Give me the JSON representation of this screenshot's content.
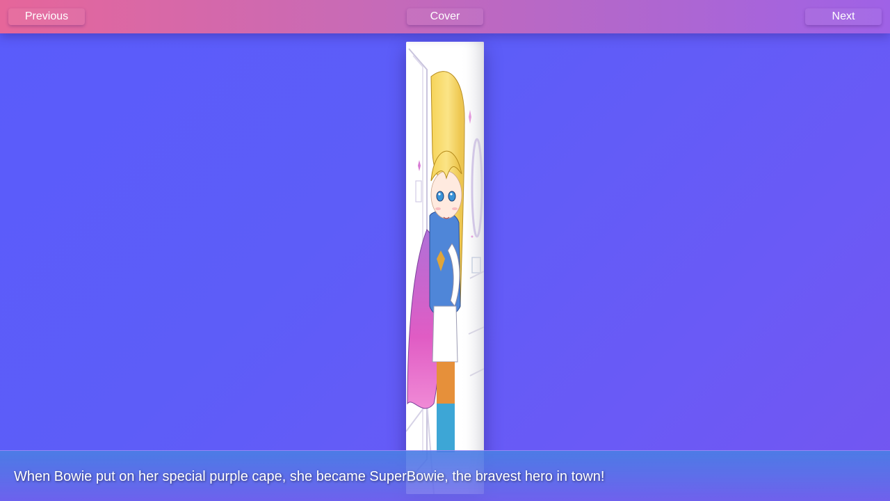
{
  "nav": {
    "previous_label": "Previous",
    "cover_label": "Cover",
    "next_label": "Next"
  },
  "page": {
    "caption": "When Bowie put on her special purple cape, she became SuperBowie, the bravest hero in town!"
  },
  "colors": {
    "background_start": "#5a5cfb",
    "background_end": "#7356f0",
    "topbar_start": "#e6669a",
    "topbar_end": "#9f62e6",
    "caption_bar": "#5a78e6"
  }
}
